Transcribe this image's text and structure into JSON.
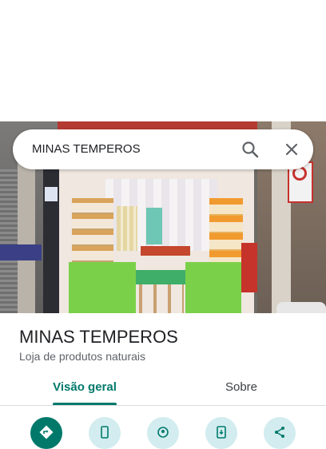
{
  "search": {
    "query": "MINAS TEMPEROS",
    "search_icon": "search-icon",
    "close_icon": "close-icon"
  },
  "place": {
    "name": "MINAS TEMPEROS",
    "category": "Loja de produtos naturais"
  },
  "tabs": [
    {
      "label": "Visão geral",
      "selected": true
    },
    {
      "label": "Sobre",
      "selected": false
    }
  ],
  "actions": [
    {
      "icon": "directions-icon",
      "style": "primary"
    },
    {
      "icon": "phone-icon"
    },
    {
      "icon": "nearby-icon"
    },
    {
      "icon": "send-to-phone-icon"
    },
    {
      "icon": "share-icon"
    }
  ],
  "colors": {
    "accent": "#00796b",
    "action_bg": "#d2ecef",
    "title": "#202124",
    "subtitle": "#5f6368"
  }
}
